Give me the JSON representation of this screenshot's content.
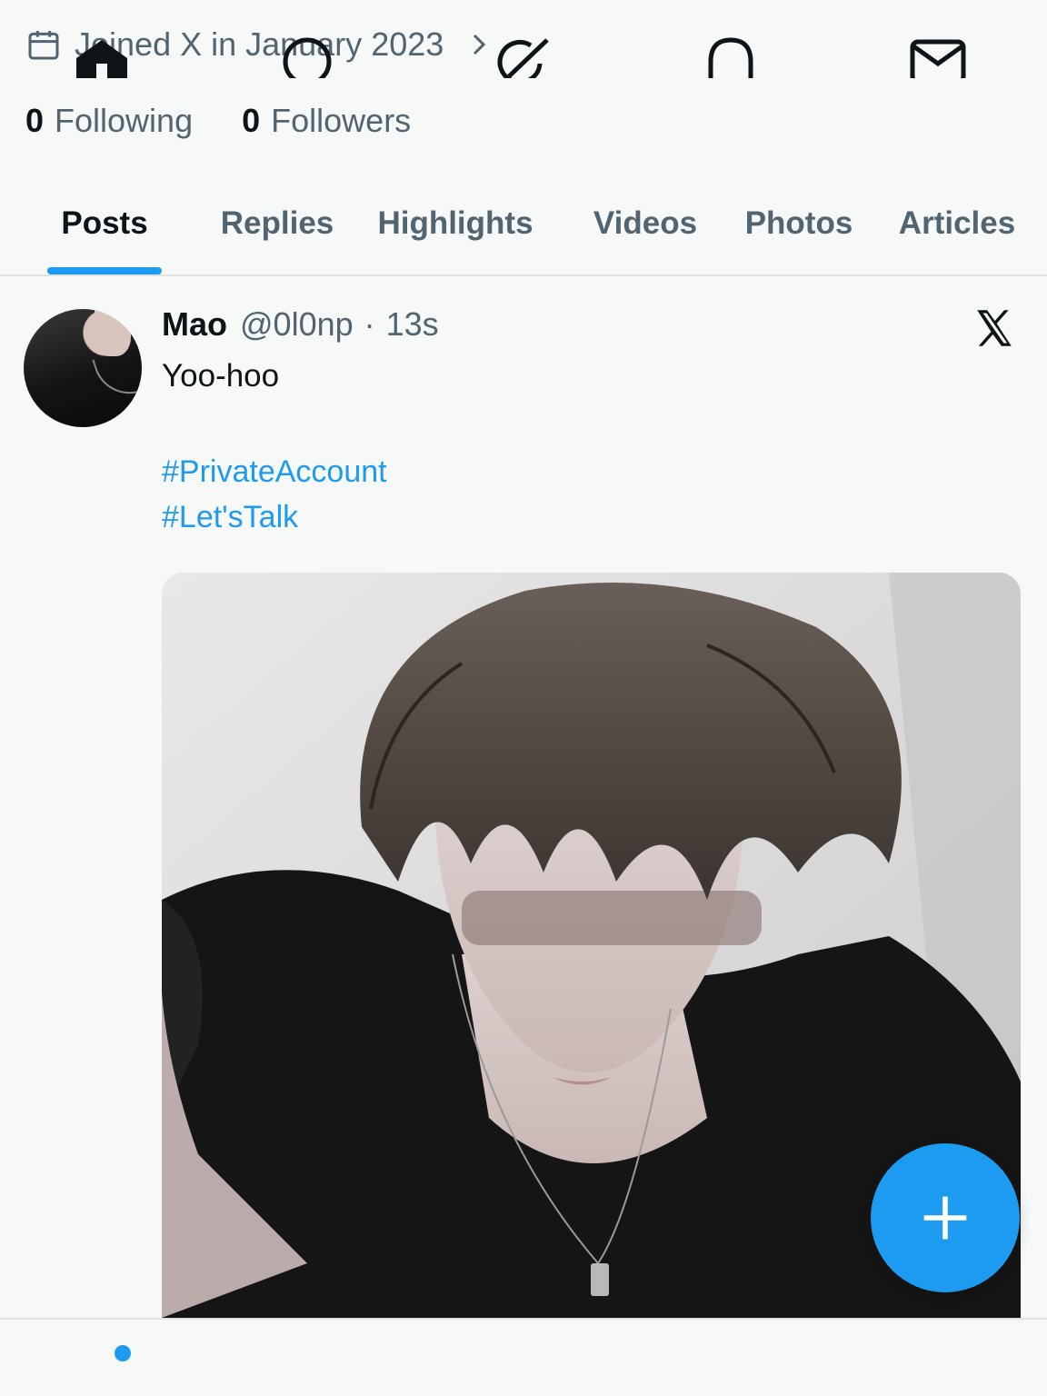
{
  "profile": {
    "joined_text": "Joined X in January 2023",
    "following_count": "0",
    "following_label": "Following",
    "followers_count": "0",
    "followers_label": "Followers"
  },
  "tabs": [
    {
      "label": "Posts",
      "active": true
    },
    {
      "label": "Replies",
      "active": false
    },
    {
      "label": "Highlights",
      "active": false
    },
    {
      "label": "Videos",
      "active": false
    },
    {
      "label": "Photos",
      "active": false
    },
    {
      "label": "Articles",
      "active": false
    }
  ],
  "post": {
    "name": "Mao",
    "handle": "@0l0np",
    "separator": "·",
    "time": "13s",
    "text": "Yoo-hoo",
    "hashtags": [
      "#PrivateAccount",
      "#Let'sTalk"
    ]
  },
  "icons": {
    "joined": "calendar-icon",
    "chevron": "chevron-right-icon",
    "brand": "x-logo-icon",
    "compose": "plus-icon",
    "nav": [
      "home-icon",
      "search-icon",
      "grok-icon",
      "notifications-icon",
      "messages-icon"
    ]
  },
  "colors": {
    "accent": "#1d9bf0",
    "text_primary": "#0f1419",
    "text_secondary": "#536471",
    "background": "#f7f8f8"
  }
}
